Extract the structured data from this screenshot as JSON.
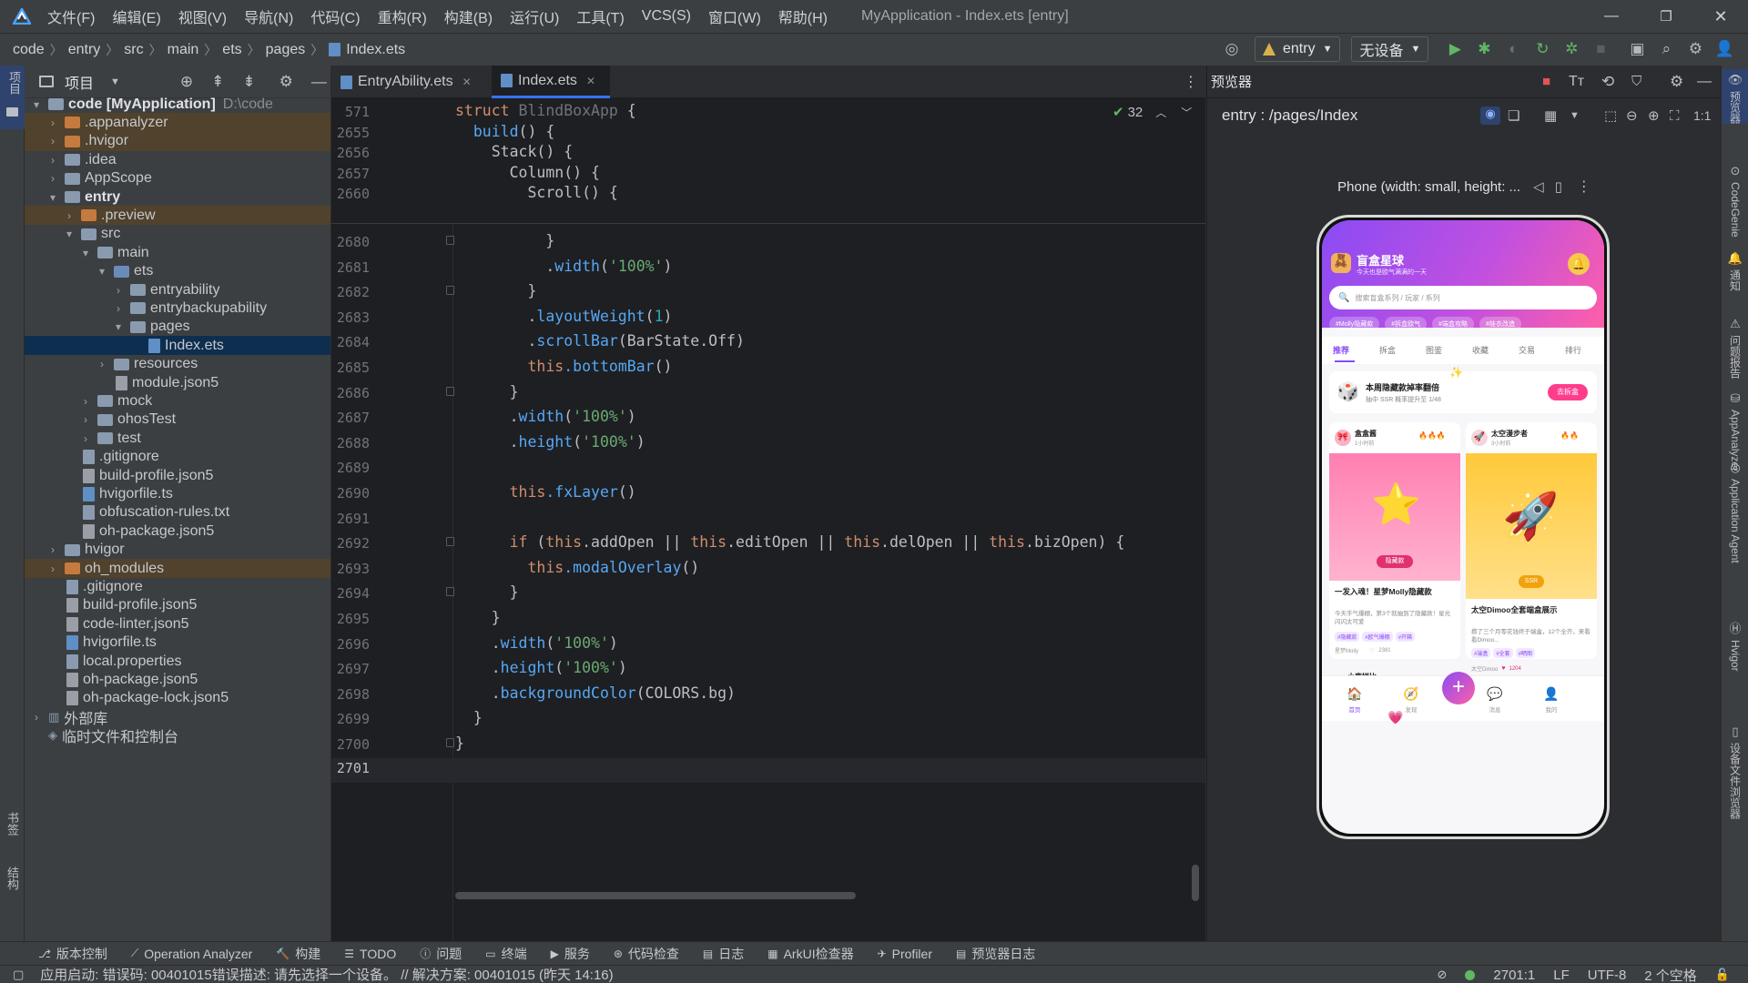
{
  "titlebar": {
    "menu": [
      "文件(F)",
      "编辑(E)",
      "视图(V)",
      "导航(N)",
      "代码(C)",
      "重构(R)",
      "构建(B)",
      "运行(U)",
      "工具(T)",
      "VCS(S)",
      "窗口(W)",
      "帮助(H)"
    ],
    "title": "MyApplication - Index.ets [entry]"
  },
  "navbar": {
    "breadcrumb": [
      "code",
      "entry",
      "src",
      "main",
      "ets",
      "pages",
      "Index.ets"
    ],
    "module_combo": "entry",
    "device_combo": "无设备"
  },
  "left_strip": {
    "top": "项目",
    "bottom1": "书签",
    "bottom2": "结构"
  },
  "project": {
    "header": "项目",
    "rows": [
      {
        "label": "code [MyApplication]",
        "path": "D:\\code",
        "depth": 0,
        "arrow": "▾",
        "kind": "folder-blue"
      },
      {
        "label": ".appanalyzer",
        "depth": 1,
        "arrow": "›",
        "kind": "folder-orange"
      },
      {
        "label": ".hvigor",
        "depth": 1,
        "arrow": "›",
        "kind": "folder-orange"
      },
      {
        "label": ".idea",
        "depth": 1,
        "arrow": "›",
        "kind": "folder-blue"
      },
      {
        "label": "AppScope",
        "depth": 1,
        "arrow": "›",
        "kind": "folder-blue"
      },
      {
        "label": "entry",
        "depth": 1,
        "arrow": "▾",
        "kind": "folder-blue"
      },
      {
        "label": ".preview",
        "depth": 2,
        "arrow": "›",
        "kind": "folder-orange"
      },
      {
        "label": "src",
        "depth": 2,
        "arrow": "▾",
        "kind": "folder-blue"
      },
      {
        "label": "main",
        "depth": 3,
        "arrow": "▾",
        "kind": "folder-blue"
      },
      {
        "label": "ets",
        "depth": 4,
        "arrow": "▾",
        "kind": "folder-src"
      },
      {
        "label": "entryability",
        "depth": 5,
        "arrow": "›",
        "kind": "folder-blue"
      },
      {
        "label": "entrybackupability",
        "depth": 5,
        "arrow": "›",
        "kind": "folder-blue"
      },
      {
        "label": "pages",
        "depth": 5,
        "arrow": "▾",
        "kind": "folder-blue"
      },
      {
        "label": "Index.ets",
        "depth": 6,
        "arrow": "",
        "kind": "file-ts"
      },
      {
        "label": "resources",
        "depth": 4,
        "arrow": "›",
        "kind": "folder-blue"
      },
      {
        "label": "module.json5",
        "depth": 4,
        "arrow": "",
        "kind": "file-json"
      },
      {
        "label": "mock",
        "depth": 3,
        "arrow": "›",
        "kind": "folder-blue"
      },
      {
        "label": "ohosTest",
        "depth": 3,
        "arrow": "›",
        "kind": "folder-blue"
      },
      {
        "label": "test",
        "depth": 3,
        "arrow": "›",
        "kind": "folder-blue"
      },
      {
        "label": ".gitignore",
        "depth": 2,
        "arrow": "",
        "kind": "file"
      },
      {
        "label": "build-profile.json5",
        "depth": 2,
        "arrow": "",
        "kind": "file-json"
      },
      {
        "label": "hvigorfile.ts",
        "depth": 2,
        "arrow": "",
        "kind": "file-ts"
      },
      {
        "label": "obfuscation-rules.txt",
        "depth": 2,
        "arrow": "",
        "kind": "file"
      },
      {
        "label": "oh-package.json5",
        "depth": 2,
        "arrow": "",
        "kind": "file-json"
      },
      {
        "label": "hvigor",
        "depth": 1,
        "arrow": "›",
        "kind": "folder-blue"
      },
      {
        "label": "oh_modules",
        "depth": 1,
        "arrow": "›",
        "kind": "folder-orange"
      },
      {
        "label": ".gitignore",
        "depth": 1,
        "arrow": "",
        "kind": "file"
      },
      {
        "label": "build-profile.json5",
        "depth": 1,
        "arrow": "",
        "kind": "file-json"
      },
      {
        "label": "code-linter.json5",
        "depth": 1,
        "arrow": "",
        "kind": "file-json"
      },
      {
        "label": "hvigorfile.ts",
        "depth": 1,
        "arrow": "",
        "kind": "file-ts"
      },
      {
        "label": "local.properties",
        "depth": 1,
        "arrow": "",
        "kind": "file"
      },
      {
        "label": "oh-package.json5",
        "depth": 1,
        "arrow": "",
        "kind": "file-json"
      },
      {
        "label": "oh-package-lock.json5",
        "depth": 1,
        "arrow": "",
        "kind": "file-json"
      },
      {
        "label": "外部库",
        "depth": 0,
        "arrow": "›",
        "kind": "lib"
      },
      {
        "label": "临时文件和控制台",
        "depth": 0,
        "arrow": "",
        "kind": "scratch"
      }
    ]
  },
  "editor": {
    "tabs": [
      "EntryAbility.ets",
      "Index.ets"
    ],
    "inspection_count": "32",
    "sticky": [
      {
        "line": "571",
        "code": "struct BlindBoxApp {"
      },
      {
        "line": "2655",
        "code": "  build() {"
      },
      {
        "line": "2656",
        "code": "    Stack() {"
      },
      {
        "line": "2657",
        "code": "      Column() {"
      },
      {
        "line": "2660",
        "code": "        Scroll() {"
      }
    ],
    "lines": [
      {
        "line": "2680",
        "code": "          }"
      },
      {
        "line": "2681",
        "code": "          .width('100%')"
      },
      {
        "line": "2682",
        "code": "        }"
      },
      {
        "line": "2683",
        "code": "        .layoutWeight(1)"
      },
      {
        "line": "2684",
        "code": "        .scrollBar(BarState.Off)"
      },
      {
        "line": "2685",
        "code": "        this.bottomBar()"
      },
      {
        "line": "2686",
        "code": "      }"
      },
      {
        "line": "2687",
        "code": "      .width('100%')"
      },
      {
        "line": "2688",
        "code": "      .height('100%')"
      },
      {
        "line": "2689",
        "code": ""
      },
      {
        "line": "2690",
        "code": "      this.fxLayer()"
      },
      {
        "line": "2691",
        "code": ""
      },
      {
        "line": "2692",
        "code": "      if (this.addOpen || this.editOpen || this.delOpen || this.bizOpen) {"
      },
      {
        "line": "2693",
        "code": "        this.modalOverlay()"
      },
      {
        "line": "2694",
        "code": "      }"
      },
      {
        "line": "2695",
        "code": "    }"
      },
      {
        "line": "2696",
        "code": "    .width('100%')"
      },
      {
        "line": "2697",
        "code": "    .height('100%')"
      },
      {
        "line": "2698",
        "code": "    .backgroundColor(COLORS.bg)"
      },
      {
        "line": "2699",
        "code": "  }"
      },
      {
        "line": "2700",
        "code": "}"
      },
      {
        "line": "2701",
        "code": ""
      }
    ]
  },
  "preview": {
    "title": "预览器",
    "route": "entry : /pages/Index",
    "device": "Phone (width: small, height: ...",
    "app": {
      "title": "盲盒星球",
      "subtitle": "今天也是欧气满满的一天",
      "search_placeholder": "搜索盲盒系列 / 玩家 / 系列",
      "chips": [
        "#Molly隐藏款",
        "#拆盒欧气",
        "#端盒攻略",
        "#娃衣改造"
      ],
      "tabs": [
        "推荐",
        "拆盒",
        "图鉴",
        "收藏",
        "交易",
        "排行"
      ],
      "banner_title": "本周隐藏款掉率翻倍",
      "banner_sub": "抽中 SSR 概率提升至 1/48",
      "banner_btn": "去拆盒",
      "card1": {
        "user": "盒盒酱",
        "time": "1小时前",
        "fire": "🔥🔥🔥",
        "badge": "隐藏款",
        "title": "一发入魂！星梦Molly隐藏款",
        "desc": "今天手气爆棚，第3个就抽到了隐藏款！星光闪闪太可爱",
        "tags": [
          "#隐藏款",
          "#欧气爆棚",
          "#开箱"
        ],
        "meta_user": "星梦Molly",
        "likes": "2381"
      },
      "card2": {
        "user": "太空漫步者",
        "time": "3小时前",
        "fire": "🔥🔥",
        "badge": "SSR",
        "title": "太空Dimoo全套端盒展示",
        "desc": "攒了三个月零花钱终于端盒，12个全齐，来看看Dimoo...",
        "tags": [
          "#端盒",
          "#全套",
          "#晒图"
        ],
        "meta_user": "太空Dimoo",
        "likes": "1204"
      },
      "card3_title": "小鹿拼比",
      "nav": [
        "首页",
        "发现",
        "",
        "消息",
        "我的"
      ]
    }
  },
  "right_strip": [
    "预览器",
    "CodeGenie",
    "通知",
    "问题报告",
    "AppAnalyzer",
    "Application Agent",
    "Hvigor",
    "设备文件浏览器"
  ],
  "toolwindows": [
    "版本控制",
    "Operation Analyzer",
    "构建",
    "TODO",
    "问题",
    "终端",
    "服务",
    "代码检查",
    "日志",
    "ArkUI检查器",
    "Profiler",
    "预览器日志"
  ],
  "status": {
    "message": "应用启动: 错误码: 00401015错误描述: 请先选择一个设备。 // 解决方案: 00401015 (昨天 14:16)",
    "position": "2701:1",
    "line_sep": "LF",
    "encoding": "UTF-8",
    "indent": "2 个空格"
  },
  "colors": {
    "accent": "#3574f0",
    "app_gradient_start": "#8a4bf5",
    "app_gradient_end": "#ff5fa8",
    "run_green": "#5fb865"
  }
}
